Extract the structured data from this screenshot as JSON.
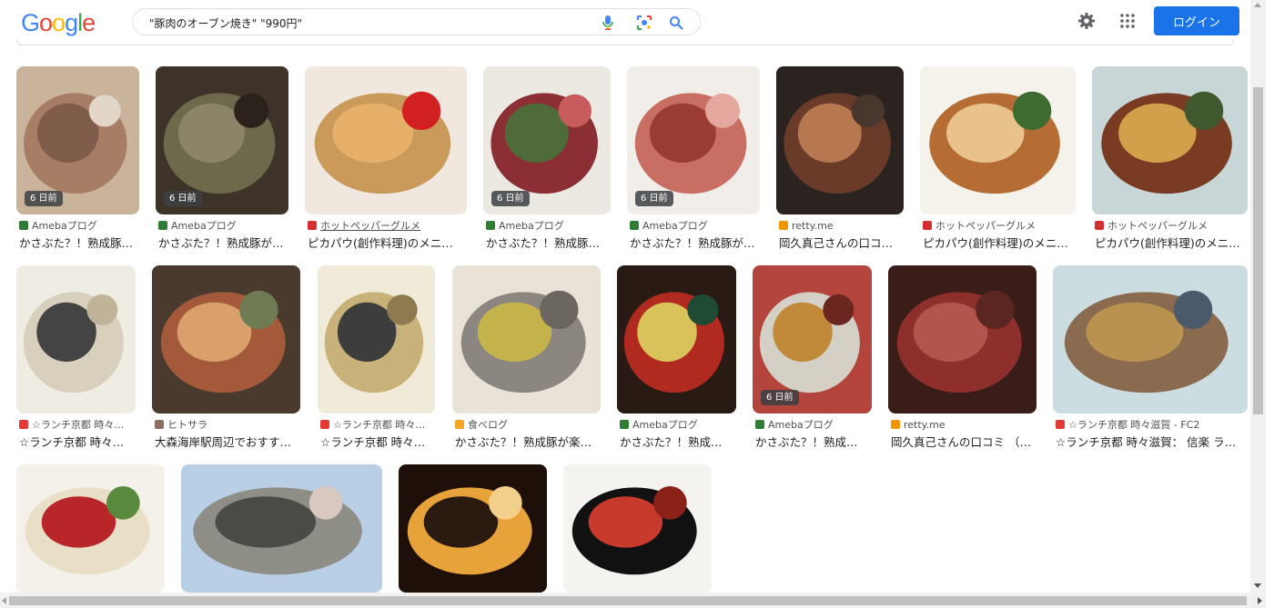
{
  "header": {
    "logo_letters": [
      {
        "ch": "G",
        "color": "#4285f4"
      },
      {
        "ch": "o",
        "color": "#ea4335"
      },
      {
        "ch": "o",
        "color": "#fbbc05"
      },
      {
        "ch": "g",
        "color": "#4285f4"
      },
      {
        "ch": "l",
        "color": "#34a853"
      },
      {
        "ch": "e",
        "color": "#ea4335"
      }
    ],
    "search_query": "\"豚肉のオーブン焼き\" \"990円\"",
    "login_label": "ログイン",
    "accent_color": "#1a73e8",
    "icons": [
      "mic-icon",
      "lens-icon",
      "search-icon",
      "gear-icon",
      "apps-grid-icon"
    ]
  },
  "results": [
    {
      "source": "Amebaプログ",
      "title": "かさぶた？！熟成豚…",
      "badge": "6 日前",
      "fav_color": "#2e7d32"
    },
    {
      "source": "Amebaプログ",
      "title": "かさぶた？！熟成豚が…",
      "badge": "6 日前",
      "fav_color": "#2e7d32"
    },
    {
      "source": "ホットペッパーグルメ",
      "title": "ピカパウ(創作料理)のメニ…",
      "badge": "",
      "fav_color": "#d32f2f"
    },
    {
      "source": "Amebaプログ",
      "title": "かさぶた？！熟成豚…",
      "badge": "6 日前",
      "fav_color": "#2e7d32"
    },
    {
      "source": "Amebaプログ",
      "title": "かさぶた？！熟成豚が…",
      "badge": "6 日前",
      "fav_color": "#2e7d32"
    },
    {
      "source": "retty.me",
      "title": "岡久真己さんの口コ…",
      "badge": "",
      "fav_color": "#f29600"
    },
    {
      "source": "ホットペッパーグルメ",
      "title": "ピカパウ(創作料理)のメニ…",
      "badge": "",
      "fav_color": "#d32f2f"
    },
    {
      "source": "ホットペッパーグルメ",
      "title": "ピカパウ(創作料理)のメニ…",
      "badge": "",
      "fav_color": "#d32f2f"
    },
    {
      "source": "☆ランチ京都 時々…",
      "title": "☆ランチ京都 時々…",
      "badge": "",
      "fav_color": "#e53935"
    },
    {
      "source": "ヒトサラ",
      "title": "大森海岸駅周辺でおすす…",
      "badge": "",
      "fav_color": "#8d6e63"
    },
    {
      "source": "☆ランチ京都 時々…",
      "title": "☆ランチ京都 時々…",
      "badge": "",
      "fav_color": "#e53935"
    },
    {
      "source": "食べログ",
      "title": "かさぶた？！熟成豚が楽…",
      "badge": "",
      "fav_color": "#f5a623"
    },
    {
      "source": "Amebaプログ",
      "title": "かさぶた？！熟成…",
      "badge": "",
      "fav_color": "#2e7d32"
    },
    {
      "source": "Amebaプログ",
      "title": "かさぶた？！熟成…",
      "badge": "6 日前",
      "fav_color": "#2e7d32"
    },
    {
      "source": "retty.me",
      "title": "岡久真己さんの口コミ （…",
      "badge": "",
      "fav_color": "#f29600"
    },
    {
      "source": "☆ランチ京都 時々滋賀 - FC2",
      "title": "☆ランチ京都 時々滋賀： 信楽 ラ…",
      "badge": "",
      "fav_color": "#e53935"
    },
    {
      "source": "",
      "title": "",
      "badge": "",
      "fav_color": "#ffffff"
    },
    {
      "source": "",
      "title": "",
      "badge": "",
      "fav_color": "#ffffff"
    },
    {
      "source": "",
      "title": "",
      "badge": "",
      "fav_color": "#ffffff"
    },
    {
      "source": "",
      "title": "",
      "badge": "",
      "fav_color": "#ffffff"
    }
  ]
}
